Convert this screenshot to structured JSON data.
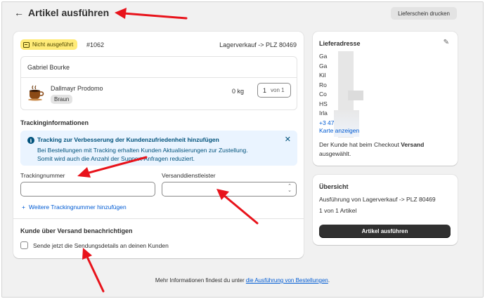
{
  "header": {
    "back_icon": "arrow-left-icon",
    "title": "Artikel ausführen",
    "print_button": "Lieferschein drucken"
  },
  "order": {
    "status": "Nicht ausgeführt",
    "number": "#1062",
    "location": "Lagerverkauf -> PLZ 80469",
    "customer": "Gabriel Bourke",
    "item": {
      "name": "Dallmayr Prodomo",
      "variant": "Braun",
      "weight": "0 kg",
      "quantity": "1",
      "quantity_of": "von 1",
      "thumb_icon": "coffee-cup-icon"
    }
  },
  "tracking": {
    "section_title": "Trackinginformationen",
    "banner_title": "Tracking zur Verbesserung der Kundenzufriedenheit hinzufügen",
    "banner_line1": "Bei Bestellungen mit Tracking erhalten Kunden Aktualisierungen zur Zustellung.",
    "banner_line2": "Somit wird auch die Anzahl der Support-Anfragen reduziert.",
    "number_label": "Trackingnummer",
    "number_value": "",
    "carrier_label": "Versanddienstleister",
    "carrier_value": "",
    "add_link": "Weitere Trackingnummer hinzufügen"
  },
  "notify": {
    "section_title": "Kunde über Versand benachrichtigen",
    "checkbox_label": "Sende jetzt die Sendungsdetails an deinen Kunden",
    "checked": false
  },
  "address": {
    "title": "Lieferadresse",
    "lines": [
      "Ga",
      "Ga",
      "Kil",
      "Ro",
      "Co",
      "HS",
      "Irla"
    ],
    "phone": "+3            477",
    "map_link": "Karte anzeigen",
    "note_prefix": "Der Kunde hat beim Checkout ",
    "note_bold": "Versand",
    "note_suffix": "ausgewählt."
  },
  "summary": {
    "title": "Übersicht",
    "line1": "Ausführung von Lagerverkauf -> PLZ 80469",
    "line2": "1 von 1 Artikel",
    "button": "Artikel ausführen"
  },
  "footer": {
    "text": "Mehr Informationen findest du unter ",
    "link": "die Ausführung von Bestellungen",
    "end": "."
  },
  "colors": {
    "annotation_arrow": "#e8131b",
    "primary_button": "#303030",
    "link": "#005bd3",
    "status_badge": "#ffeb78",
    "info_banner": "#eaf4ff"
  }
}
